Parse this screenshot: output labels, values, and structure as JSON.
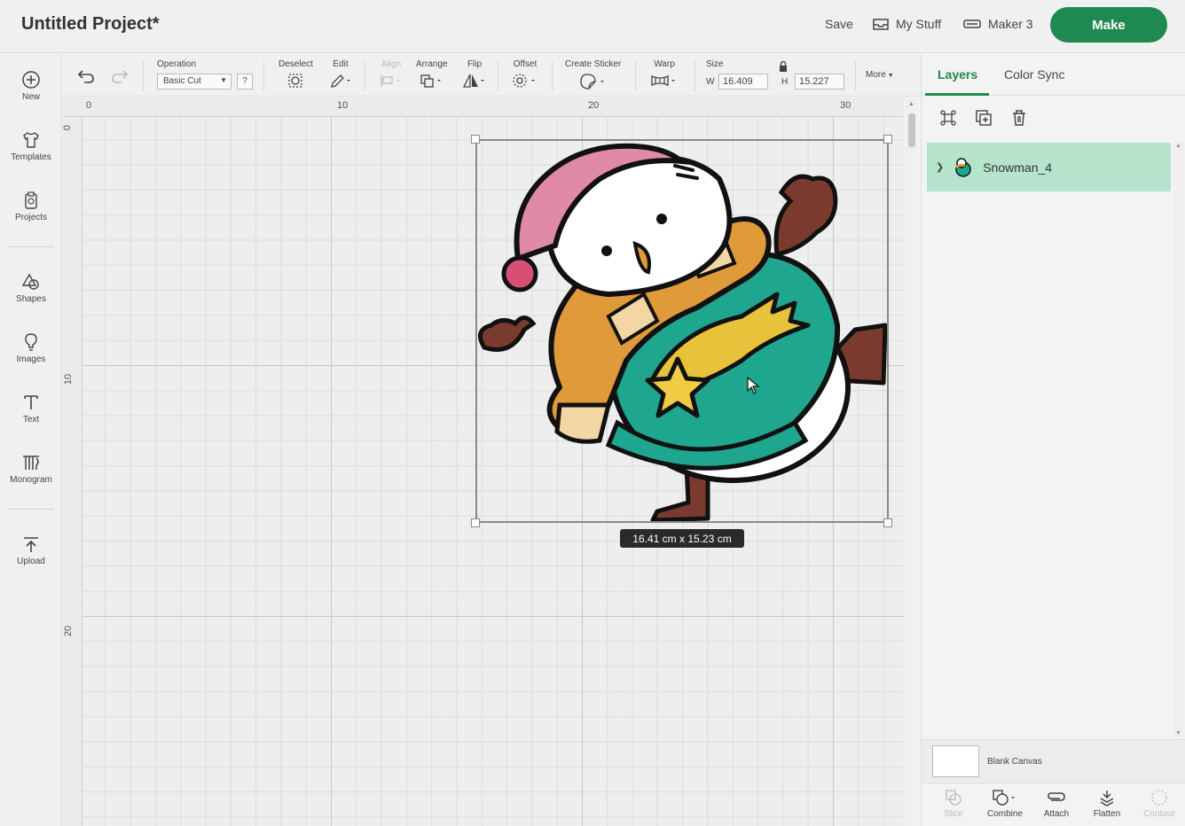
{
  "header": {
    "title": "Untitled Project*",
    "save": "Save",
    "my_stuff": "My Stuff",
    "machine": "Maker 3",
    "make": "Make"
  },
  "sidebar": {
    "items": [
      {
        "label": "New",
        "icon": "plus-circle-icon"
      },
      {
        "label": "Templates",
        "icon": "shirt-icon"
      },
      {
        "label": "Projects",
        "icon": "clipboard-icon"
      },
      {
        "label": "Shapes",
        "icon": "shapes-icon"
      },
      {
        "label": "Images",
        "icon": "lightbulb-icon"
      },
      {
        "label": "Text",
        "icon": "text-icon"
      },
      {
        "label": "Monogram",
        "icon": "monogram-icon"
      },
      {
        "label": "Upload",
        "icon": "upload-icon"
      }
    ]
  },
  "toolbar": {
    "operation_label": "Operation",
    "operation_value": "Basic Cut",
    "help": "?",
    "deselect": "Deselect",
    "edit": "Edit",
    "align": "Align",
    "arrange": "Arrange",
    "flip": "Flip",
    "offset": "Offset",
    "create_sticker": "Create Sticker",
    "warp": "Warp",
    "size": "Size",
    "w_label": "W",
    "w_value": "16.409",
    "h_label": "H",
    "h_value": "15.227",
    "more": "More"
  },
  "canvas": {
    "ruler_top": [
      "0",
      "10",
      "20",
      "30"
    ],
    "ruler_left": [
      "0",
      "10",
      "20"
    ],
    "dimension_label": "16.41  cm x 15.23  cm"
  },
  "panel": {
    "tabs": [
      "Layers",
      "Color Sync"
    ],
    "layer_name": "Snowman_4",
    "blank_canvas": "Blank Canvas",
    "tools": [
      {
        "label": "Slice",
        "enabled": false
      },
      {
        "label": "Combine",
        "enabled": true
      },
      {
        "label": "Attach",
        "enabled": true
      },
      {
        "label": "Flatten",
        "enabled": true
      },
      {
        "label": "Contour",
        "enabled": false
      }
    ]
  },
  "colors": {
    "accent": "#1e8a52",
    "layer_selected": "#b5e3cc",
    "snowman_hat": "#e08aa5",
    "snowman_scarf": "#e09a3a",
    "snowman_sweater": "#1fa68f",
    "snowman_star": "#e8c23a",
    "snowman_mitten": "#7a3b2e"
  }
}
